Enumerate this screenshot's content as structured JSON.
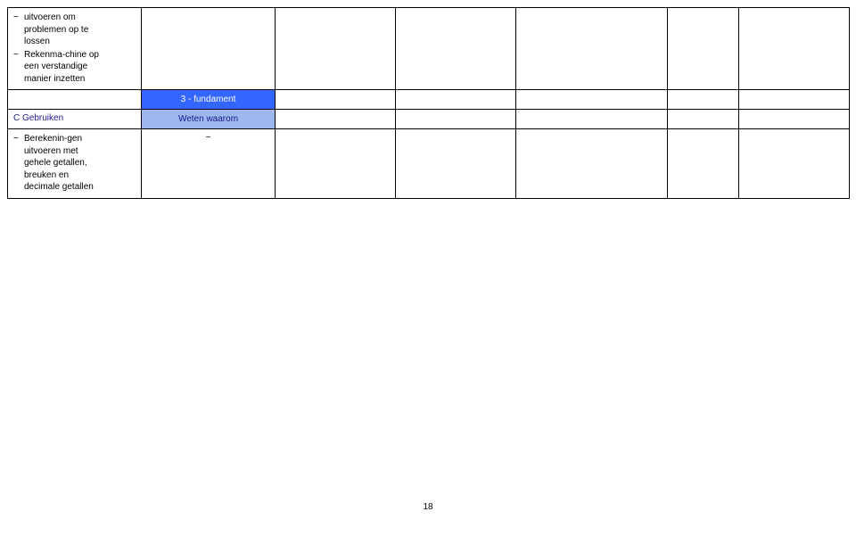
{
  "row1": {
    "item1_l1": "uitvoeren om",
    "item1_l2": "problemen op te",
    "item1_l3": "lossen",
    "item2_l1": "Rekenma-chine op",
    "item2_l2": "een verstandige",
    "item2_l3": "manier inzetten"
  },
  "row2": {
    "label": "3 - fundament"
  },
  "row3": {
    "col0": "C Gebruiken",
    "col1": "Weten waarom"
  },
  "row4": {
    "item1_l1": "Berekenin-gen",
    "item1_l2": "uitvoeren met",
    "item1_l3": "gehele getallen,",
    "item1_l4": "breuken en",
    "item1_l5": "decimale getallen",
    "col1": "−"
  },
  "pagenum": "18"
}
